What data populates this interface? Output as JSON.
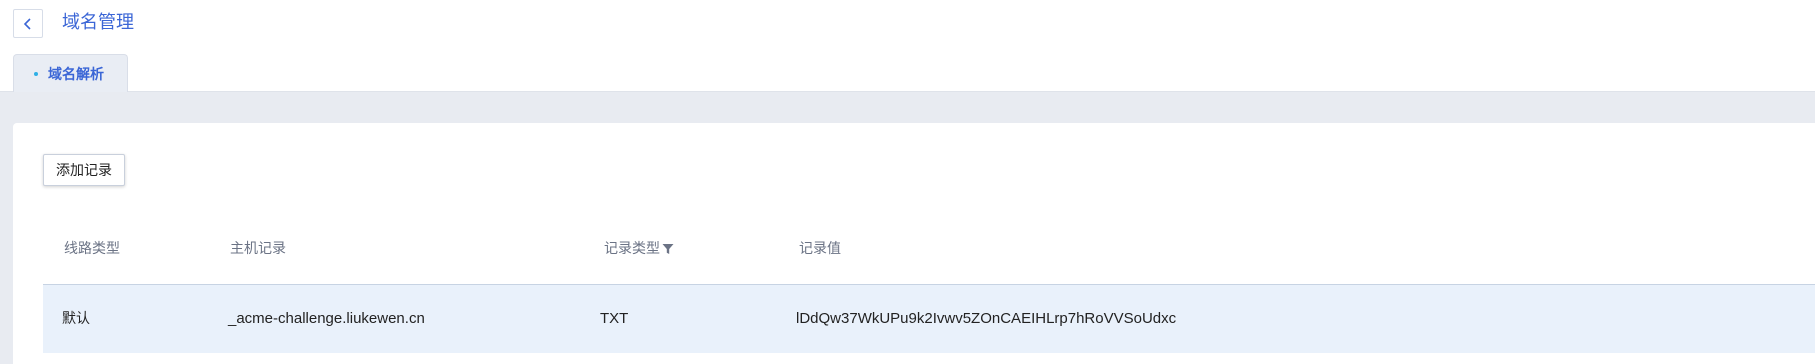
{
  "header": {
    "title": "域名管理",
    "back_icon": "chevron-left-icon"
  },
  "tabs": [
    {
      "label": "域名解析",
      "active": true
    }
  ],
  "toolbar": {
    "add_label": "添加记录"
  },
  "table": {
    "columns": [
      "线路类型",
      "主机记录",
      "记录类型",
      "记录值"
    ],
    "rows": [
      {
        "line_type": "默认",
        "host": "_acme-challenge.liukewen.cn",
        "record_type": "TXT",
        "value": "lDdQw37WkUPu9k2Ivwv5ZOnCAEIHLrp7hRoVVSoUdxc"
      }
    ]
  },
  "colors": {
    "accent": "#3b66d6",
    "tab_dot": "#2fb0e6",
    "row_highlight": "#e9f1fb",
    "page_bg": "#e8ebf1"
  }
}
